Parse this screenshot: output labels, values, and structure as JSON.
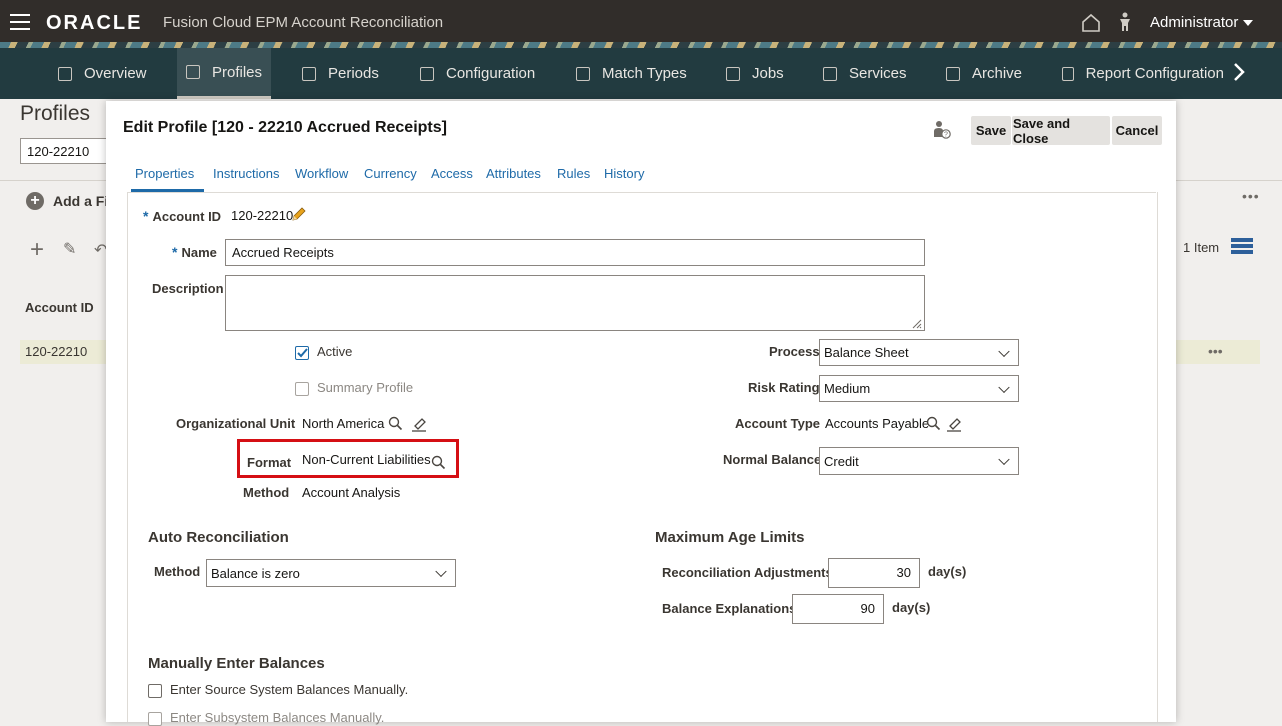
{
  "header": {
    "logo": "ORACLE",
    "app_title": "Fusion Cloud EPM Account Reconciliation",
    "user": "Administrator"
  },
  "nav": {
    "items": [
      {
        "label": "Overview",
        "icon": "cube-icon"
      },
      {
        "label": "Profiles",
        "icon": "clipboard-icon",
        "active": true
      },
      {
        "label": "Periods",
        "icon": "sliders-icon"
      },
      {
        "label": "Configuration",
        "icon": "tools-icon"
      },
      {
        "label": "Match Types",
        "icon": "document-match-icon"
      },
      {
        "label": "Jobs",
        "icon": "clipboard-jobs-icon"
      },
      {
        "label": "Services",
        "icon": "briefcase-icon"
      },
      {
        "label": "Archive",
        "icon": "location-pin-icon"
      },
      {
        "label": "Report Configuration",
        "icon": "report-icon"
      }
    ]
  },
  "background": {
    "title": "Profiles",
    "search_value": "120-22210",
    "add_filter": "Add a Fi",
    "column_account_id": "Account ID",
    "row_account_id": "120-22210",
    "item_count": "1 Item"
  },
  "dialog": {
    "title": "Edit Profile [120 - 22210 Accrued Receipts]",
    "buttons": {
      "save": "Save",
      "save_close": "Save and Close",
      "cancel": "Cancel"
    },
    "tabs": [
      "Properties",
      "Instructions",
      "Workflow",
      "Currency",
      "Access",
      "Attributes",
      "Rules",
      "History"
    ],
    "properties": {
      "account_id_label": "Account ID",
      "account_id": "120-22210",
      "name_label": "Name",
      "name": "Accrued Receipts",
      "description_label": "Description",
      "description": "",
      "active_label": "Active",
      "active": true,
      "summary_profile_label": "Summary Profile",
      "summary_profile": false,
      "org_unit_label": "Organizational Unit",
      "org_unit": "North America",
      "format_label": "Format",
      "format": "Non-Current Liabilities",
      "method_label": "Method",
      "method": "Account Analysis",
      "process_label": "Process",
      "process": "Balance Sheet",
      "risk_rating_label": "Risk Rating",
      "risk_rating": "Medium",
      "account_type_label": "Account Type",
      "account_type": "Accounts Payable",
      "normal_balance_label": "Normal Balance",
      "normal_balance": "Credit"
    },
    "auto_reconciliation": {
      "title": "Auto Reconciliation",
      "method_label": "Method",
      "method": "Balance is zero"
    },
    "max_age_limits": {
      "title": "Maximum Age Limits",
      "recon_adjustments_label": "Reconciliation Adjustments",
      "recon_adjustments": "30",
      "balance_explanations_label": "Balance Explanations",
      "balance_explanations": "90",
      "unit": "day(s)"
    },
    "manual_balances": {
      "title": "Manually Enter Balances",
      "source_label": "Enter Source System Balances Manually.",
      "subsystem_label": "Enter Subsystem Balances Manually."
    }
  },
  "colors": {
    "header_bg": "#312d2a",
    "nav_bg": "#223b40",
    "link": "#1e6aa8",
    "highlight": "#d50f14"
  }
}
